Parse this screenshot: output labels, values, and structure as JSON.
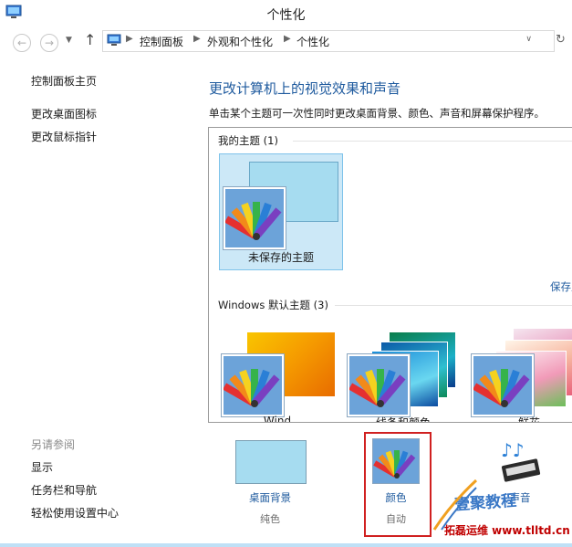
{
  "window": {
    "title": "个性化"
  },
  "nav": {
    "back_icon": "back-arrow-icon",
    "forward_icon": "forward-arrow-icon",
    "up_icon": "up-arrow-icon",
    "breadcrumbs": [
      "控制面板",
      "外观和个性化",
      "个性化"
    ]
  },
  "sidebar": {
    "links": [
      "控制面板主页",
      "更改桌面图标",
      "更改鼠标指针"
    ],
    "see_also_title": "另请参阅",
    "see_also": [
      "显示",
      "任务栏和导航",
      "轻松使用设置中心"
    ]
  },
  "main": {
    "heading": "更改计算机上的视觉效果和声音",
    "description": "单击某个主题可一次性同时更改桌面背景、颜色、声音和屏幕保护程序。",
    "my_themes_header": "我的主题 (1)",
    "unsaved_theme": "未保存的主题",
    "save_theme": "保存主题",
    "default_themes_header": "Windows 默认主题 (3)",
    "default_themes": [
      "Wind",
      "线条和颜色",
      "鲜花"
    ]
  },
  "bottom": {
    "desktop_bg_label": "桌面背景",
    "desktop_bg_sub": "纯色",
    "color_label": "颜色",
    "color_sub": "自动",
    "sound_label": "声音"
  },
  "watermark": {
    "text": "壹聚教程",
    "url": "拓磊运维 www.tlltd.cn"
  },
  "colors": {
    "accent": "#1e5a9e",
    "selection": "#cce8f7",
    "highlight_box": "#d02020"
  }
}
